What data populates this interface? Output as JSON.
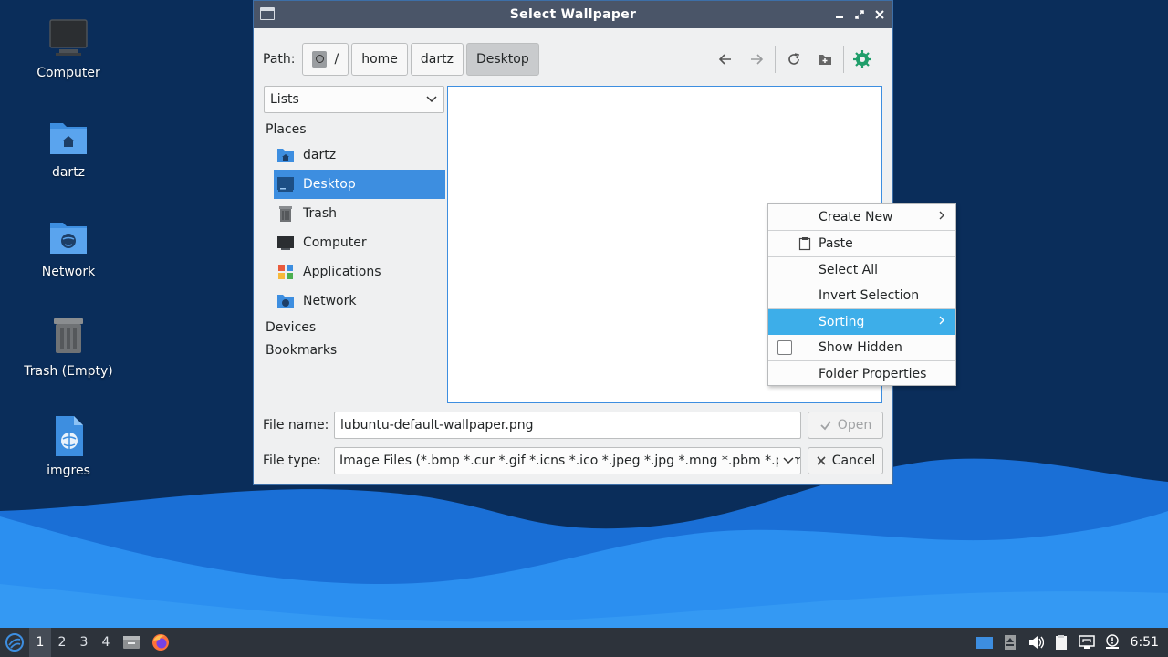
{
  "desktop": {
    "icons": [
      {
        "label": "Computer",
        "icon": "computer-icon"
      },
      {
        "label": "dartz",
        "icon": "home-folder-icon"
      },
      {
        "label": "Network",
        "icon": "network-folder-icon"
      },
      {
        "label": "Trash (Empty)",
        "icon": "trash-icon"
      },
      {
        "label": "imgres",
        "icon": "html-file-icon"
      }
    ],
    "colors": {
      "background_dark": "#0a2d5a",
      "wave_light": "#2b8ff0",
      "wave_mid": "#1a6fd6"
    }
  },
  "dialog": {
    "title": "Select Wallpaper",
    "path_label": "Path:",
    "breadcrumbs": [
      "/",
      "home",
      "dartz",
      "Desktop"
    ],
    "active_crumb": "Desktop",
    "view_mode": "Lists",
    "places": {
      "header": "Places",
      "items": [
        {
          "label": "dartz",
          "icon": "home-folder-icon"
        },
        {
          "label": "Desktop",
          "icon": "desktop-icon",
          "selected": true
        },
        {
          "label": "Trash",
          "icon": "trash-icon"
        },
        {
          "label": "Computer",
          "icon": "computer-icon"
        },
        {
          "label": "Applications",
          "icon": "applications-icon"
        },
        {
          "label": "Network",
          "icon": "network-folder-icon"
        }
      ],
      "devices_header": "Devices",
      "bookmarks_header": "Bookmarks"
    },
    "file_name_label": "File name:",
    "file_name_value": "lubuntu-default-wallpaper.png",
    "file_type_label": "File type:",
    "file_type_value": "Image Files (*.bmp *.cur *.gif *.icns *.ico *.jpeg *.jpg *.mng *.pbm *.pgm",
    "open_label": "Open",
    "cancel_label": "Cancel",
    "accent": "#3d8ee0"
  },
  "context_menu": {
    "items": [
      {
        "label": "Create New",
        "submenu": true
      },
      {
        "label": "Paste",
        "icon": "clipboard-icon"
      },
      {
        "label": "Select All"
      },
      {
        "label": "Invert Selection"
      },
      {
        "label": "Sorting",
        "submenu": true,
        "highlighted": true
      },
      {
        "label": "Show Hidden",
        "checkbox": true,
        "checked": false
      },
      {
        "label": "Folder Properties"
      }
    ],
    "highlight_color": "#3daee9"
  },
  "taskbar": {
    "workspaces": [
      "1",
      "2",
      "3",
      "4"
    ],
    "active_workspace": "1",
    "clock": "6:51"
  }
}
